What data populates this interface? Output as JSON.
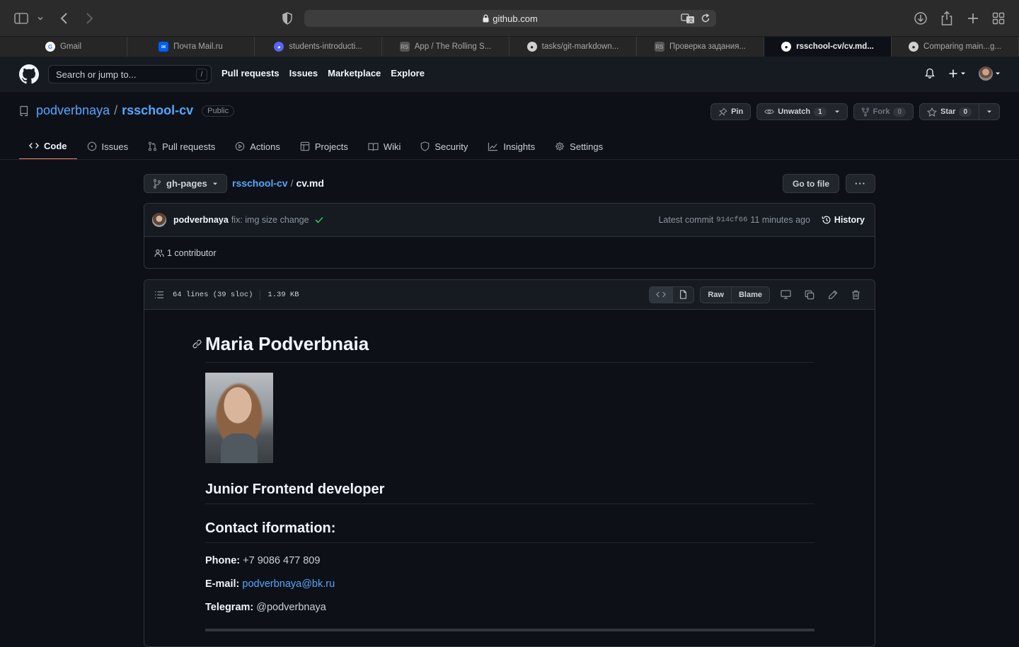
{
  "browser": {
    "url": "github.com",
    "tabs": [
      {
        "label": "Gmail",
        "icon": "google-icon",
        "color": "#ffffff"
      },
      {
        "label": "Почта Mail.ru",
        "icon": "mailru-icon",
        "color": "#005ff9"
      },
      {
        "label": "students-introducti...",
        "icon": "discord-icon",
        "color": "#5865f2"
      },
      {
        "label": "App / The Rolling S...",
        "icon": "rs-icon",
        "color": "#555555"
      },
      {
        "label": "tasks/git-markdown...",
        "icon": "github-icon",
        "color": "#d0d0d0"
      },
      {
        "label": "Проверка задания...",
        "icon": "rs-icon",
        "color": "#555555"
      },
      {
        "label": "rsschool-cv/cv.md...",
        "icon": "github-icon",
        "color": "#ffffff",
        "active": true
      },
      {
        "label": "Comparing main...g...",
        "icon": "github-icon",
        "color": "#d0d0d0"
      }
    ]
  },
  "header": {
    "search_placeholder": "Search or jump to...",
    "search_key": "/",
    "nav": [
      "Pull requests",
      "Issues",
      "Marketplace",
      "Explore"
    ]
  },
  "repo": {
    "owner": "podverbnaya",
    "separator": "/",
    "name": "rsschool-cv",
    "visibility": "Public",
    "pin": "Pin",
    "unwatch": "Unwatch",
    "watch_count": "1",
    "fork": "Fork",
    "fork_count": "0",
    "star": "Star",
    "star_count": "0",
    "tabs": [
      "Code",
      "Issues",
      "Pull requests",
      "Actions",
      "Projects",
      "Wiki",
      "Security",
      "Insights",
      "Settings"
    ]
  },
  "file_nav": {
    "branch": "gh-pages",
    "crumb_repo": "rsschool-cv",
    "crumb_sep": "/",
    "crumb_file": "cv.md",
    "goto": "Go to file",
    "more": "···"
  },
  "commit": {
    "author": "podverbnaya",
    "message": "fix: img size change",
    "latest_label": "Latest commit",
    "sha": "914cf66",
    "time": "11 minutes ago",
    "history": "History",
    "contributors": "1 contributor"
  },
  "file": {
    "lines": "64 lines (39 sloc)",
    "size": "1.39 KB",
    "raw": "Raw",
    "blame": "Blame"
  },
  "content": {
    "name": "Maria Podverbnaia",
    "role": "Junior Frontend developer",
    "contact_heading": "Contact iformation:",
    "phone_label": "Phone:",
    "phone": " +7 9086 477 809",
    "email_label": "E-mail:",
    "email": "podverbnaya@bk.ru",
    "telegram_label": "Telegram:",
    "telegram": " @podverbnaya"
  }
}
